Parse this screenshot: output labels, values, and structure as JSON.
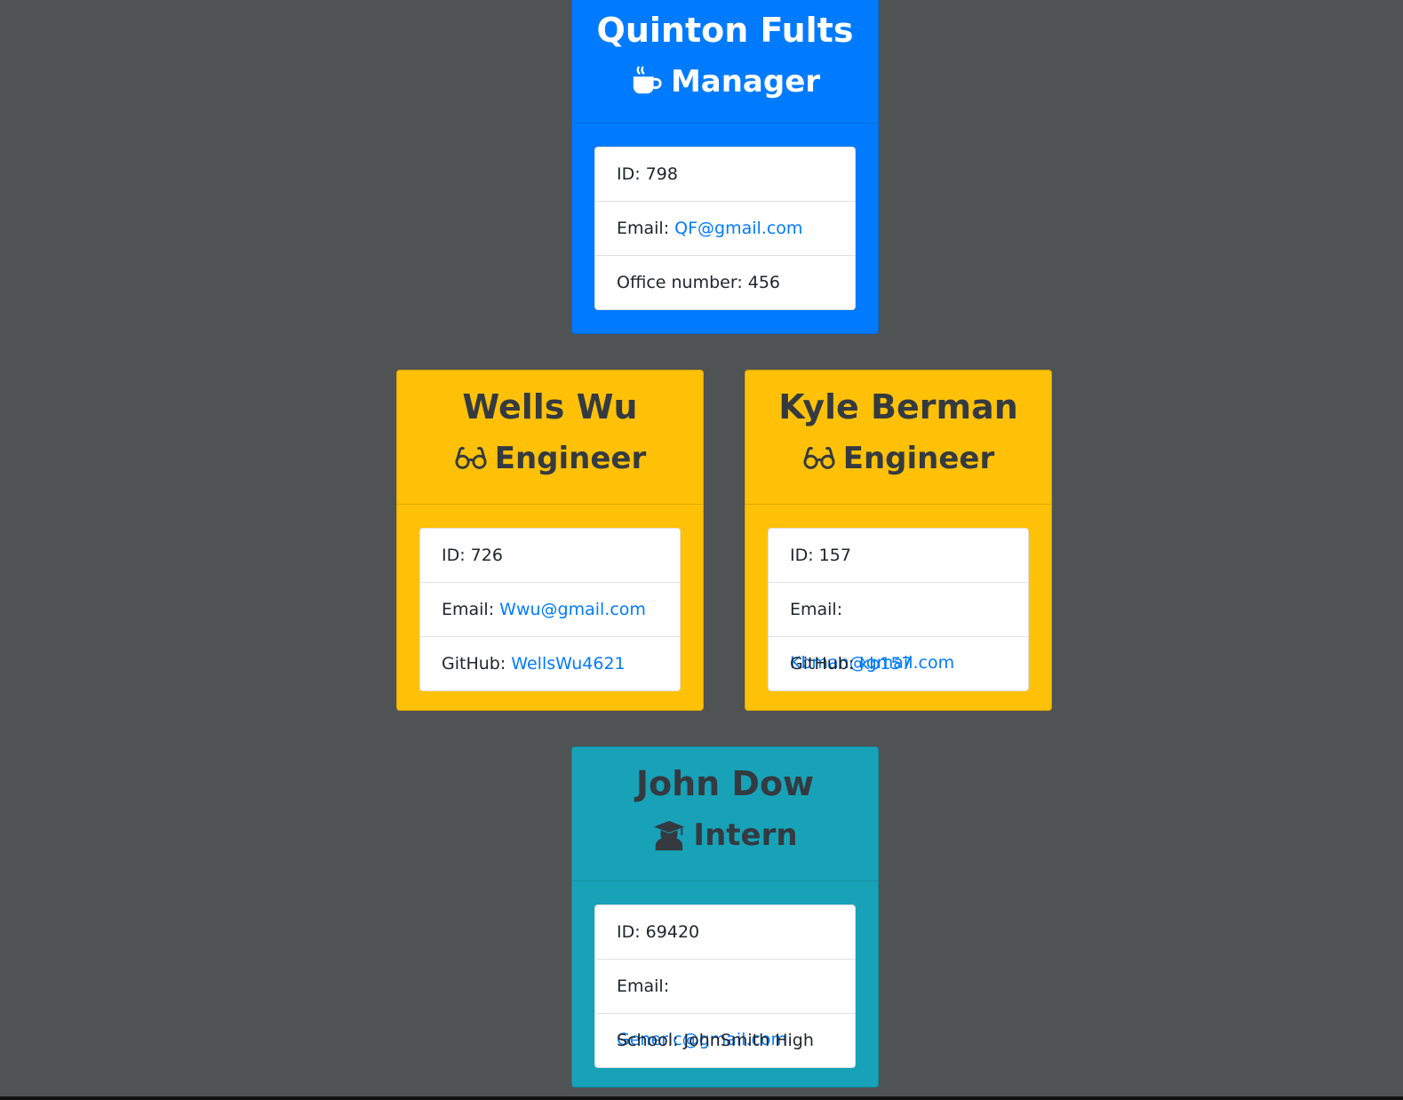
{
  "team": {
    "manager": {
      "name": "Quinton Fults",
      "role": "Manager",
      "icon": "coffee-icon",
      "id_label": "ID: 798",
      "email_prefix": "Email: ",
      "email": "QF@gmail.com",
      "office_label": "Office number: 456",
      "color": "#007bff"
    },
    "engineers": [
      {
        "name": "Wells Wu",
        "role": "Engineer",
        "icon": "glasses-icon",
        "id_label": "ID: 726",
        "email_prefix": "Email: ",
        "email": "Wwu@gmail.com",
        "github_prefix": "GitHub: ",
        "github": "WellsWu4621",
        "color": "#ffc107"
      },
      {
        "name": "Kyle Berman",
        "role": "Engineer",
        "icon": "glasses-icon",
        "id_label": "ID: 157",
        "email_prefix": "Email: ",
        "email": "Kbman@gmail.com",
        "github_prefix": "GitHub: ",
        "github": "kb157",
        "color": "#ffc107"
      }
    ],
    "intern": {
      "name": "John Dow",
      "role": "Intern",
      "icon": "graduate-icon",
      "id_label": "ID: 69420",
      "email_prefix": "Email: ",
      "email": "Generic@gmail.com",
      "school_label": "School: JohnSmith High",
      "color": "#17a2b8"
    }
  },
  "page": {
    "background": "#4f5354",
    "link_color": "#007bff"
  }
}
